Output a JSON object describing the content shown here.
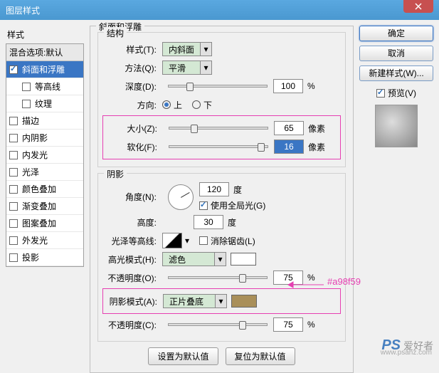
{
  "window": {
    "title": "图层样式"
  },
  "left": {
    "styles_label": "样式",
    "blend_default": "混合选项:默认",
    "items": [
      {
        "label": "斜面和浮雕",
        "checked": true,
        "selected": true
      },
      {
        "label": "等高线",
        "checked": false,
        "indent": true
      },
      {
        "label": "纹理",
        "checked": false,
        "indent": true
      },
      {
        "label": "描边",
        "checked": false
      },
      {
        "label": "内阴影",
        "checked": false
      },
      {
        "label": "内发光",
        "checked": false
      },
      {
        "label": "光泽",
        "checked": false
      },
      {
        "label": "颜色叠加",
        "checked": false
      },
      {
        "label": "渐变叠加",
        "checked": false
      },
      {
        "label": "图案叠加",
        "checked": false
      },
      {
        "label": "外发光",
        "checked": false
      },
      {
        "label": "投影",
        "checked": false
      }
    ]
  },
  "main": {
    "group_title": "斜面和浮雕",
    "structure": {
      "title": "结构",
      "style_label": "样式(T):",
      "style_value": "内斜面",
      "technique_label": "方法(Q):",
      "technique_value": "平滑",
      "depth_label": "深度(D):",
      "depth_value": "100",
      "depth_unit": "%",
      "direction_label": "方向:",
      "dir_up": "上",
      "dir_down": "下",
      "size_label": "大小(Z):",
      "size_value": "65",
      "size_unit": "像素",
      "soften_label": "软化(F):",
      "soften_value": "16",
      "soften_unit": "像素"
    },
    "shading": {
      "title": "阴影",
      "angle_label": "角度(N):",
      "angle_value": "120",
      "angle_unit": "度",
      "global_label": "使用全局光(G)",
      "altitude_label": "高度:",
      "altitude_value": "30",
      "altitude_unit": "度",
      "gloss_label": "光泽等高线:",
      "antialias_label": "消除锯齿(L)",
      "highlight_label": "高光模式(H):",
      "highlight_value": "滤色",
      "highlight_opacity_label": "不透明度(O):",
      "highlight_opacity_value": "75",
      "pct": "%",
      "shadow_label": "阴影模式(A):",
      "shadow_value": "正片叠底",
      "shadow_opacity_label": "不透明度(C):",
      "shadow_opacity_value": "75"
    },
    "buttons": {
      "default": "设置为默认值",
      "reset": "复位为默认值"
    }
  },
  "right": {
    "ok": "确定",
    "cancel": "取消",
    "new_style": "新建样式(W)...",
    "preview": "预览(V)"
  },
  "annotation": {
    "color_hex": "#a98f59"
  },
  "watermark": {
    "ps": "PS",
    "txt": "爱好者",
    "url": "www.psahz.com"
  }
}
